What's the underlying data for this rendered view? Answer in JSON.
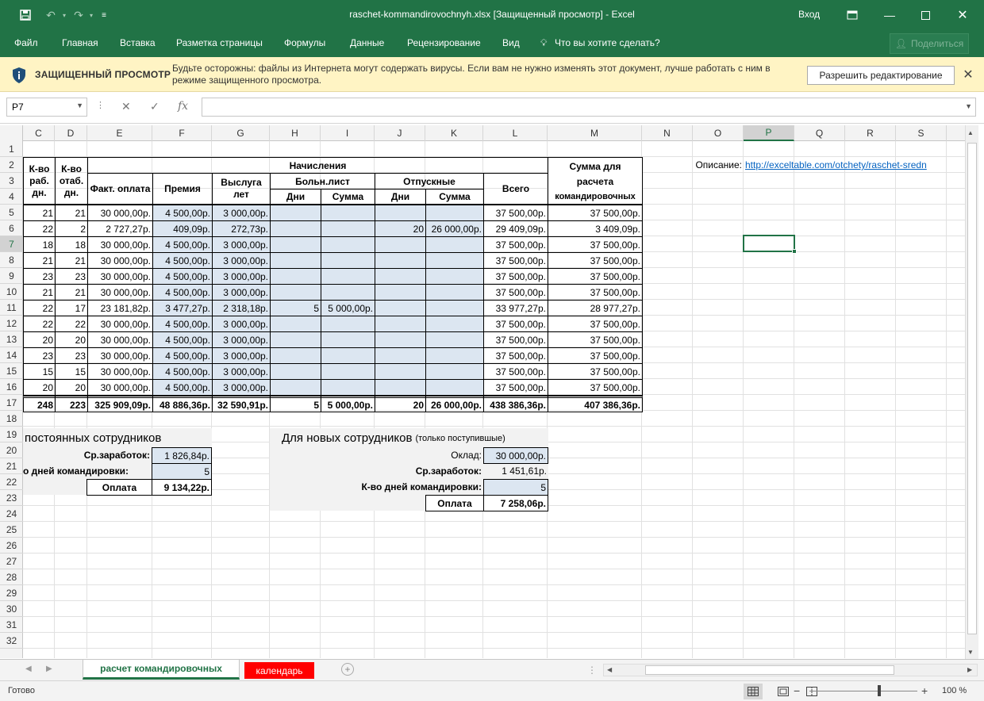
{
  "window": {
    "title": "raschet-kommandirovochnyh.xlsx  [Защищенный просмотр]  -  Excel",
    "login": "Вход"
  },
  "ribbon": {
    "tabs": [
      "Файл",
      "Главная",
      "Вставка",
      "Разметка страницы",
      "Формулы",
      "Данные",
      "Рецензирование",
      "Вид"
    ],
    "tell_me": "Что вы хотите сделать?",
    "share": "Поделиться"
  },
  "protected_view": {
    "title": "ЗАЩИЩЕННЫЙ ПРОСМОТР",
    "message": "Будьте осторожны: файлы из Интернета могут содержать вирусы. Если вам не нужно изменять этот документ, лучше работать с ним в режиме защищенного просмотра.",
    "enable_button": "Разрешить редактирование"
  },
  "formula_bar": {
    "name_box": "P7",
    "formula": ""
  },
  "columns": [
    "C",
    "D",
    "E",
    "F",
    "G",
    "H",
    "I",
    "J",
    "K",
    "L",
    "M",
    "N",
    "O",
    "P",
    "Q",
    "R",
    "S"
  ],
  "rows": [
    "1",
    "2",
    "3",
    "4",
    "5",
    "6",
    "7",
    "8",
    "9",
    "10",
    "11",
    "12",
    "13",
    "14",
    "15",
    "16",
    "17",
    "18",
    "19",
    "20",
    "21",
    "22",
    "23",
    "24",
    "25",
    "26",
    "27",
    "28",
    "29",
    "30",
    "31",
    "32"
  ],
  "header": {
    "c_work_days": "К-во раб. дн.",
    "d_tab_days": "К-во отаб. дн.",
    "accruals": "Начисления",
    "fact_pay": "Факт. оплата",
    "bonus": "Премия",
    "seniority": "Выслуга лет",
    "sick": "Больн.лист",
    "vacation": "Отпускные",
    "days": "Дни",
    "sum": "Сумма",
    "total": "Всего",
    "m_line1": "Сумма для",
    "m_line2": "расчета",
    "m_line3": "командировочных"
  },
  "table_rows": [
    [
      "21",
      "21",
      "30 000,00р.",
      "4 500,00р.",
      "3 000,00р.",
      "",
      "",
      "",
      "",
      "37 500,00р.",
      "37 500,00р."
    ],
    [
      "22",
      "2",
      "2 727,27р.",
      "409,09р.",
      "272,73р.",
      "",
      "",
      "20",
      "26 000,00р.",
      "29 409,09р.",
      "3 409,09р."
    ],
    [
      "18",
      "18",
      "30 000,00р.",
      "4 500,00р.",
      "3 000,00р.",
      "",
      "",
      "",
      "",
      "37 500,00р.",
      "37 500,00р."
    ],
    [
      "21",
      "21",
      "30 000,00р.",
      "4 500,00р.",
      "3 000,00р.",
      "",
      "",
      "",
      "",
      "37 500,00р.",
      "37 500,00р."
    ],
    [
      "23",
      "23",
      "30 000,00р.",
      "4 500,00р.",
      "3 000,00р.",
      "",
      "",
      "",
      "",
      "37 500,00р.",
      "37 500,00р."
    ],
    [
      "21",
      "21",
      "30 000,00р.",
      "4 500,00р.",
      "3 000,00р.",
      "",
      "",
      "",
      "",
      "37 500,00р.",
      "37 500,00р."
    ],
    [
      "22",
      "17",
      "23 181,82р.",
      "3 477,27р.",
      "2 318,18р.",
      "5",
      "5 000,00р.",
      "",
      "",
      "33 977,27р.",
      "28 977,27р."
    ],
    [
      "22",
      "22",
      "30 000,00р.",
      "4 500,00р.",
      "3 000,00р.",
      "",
      "",
      "",
      "",
      "37 500,00р.",
      "37 500,00р."
    ],
    [
      "20",
      "20",
      "30 000,00р.",
      "4 500,00р.",
      "3 000,00р.",
      "",
      "",
      "",
      "",
      "37 500,00р.",
      "37 500,00р."
    ],
    [
      "23",
      "23",
      "30 000,00р.",
      "4 500,00р.",
      "3 000,00р.",
      "",
      "",
      "",
      "",
      "37 500,00р.",
      "37 500,00р."
    ],
    [
      "15",
      "15",
      "30 000,00р.",
      "4 500,00р.",
      "3 000,00р.",
      "",
      "",
      "",
      "",
      "37 500,00р.",
      "37 500,00р."
    ],
    [
      "20",
      "20",
      "30 000,00р.",
      "4 500,00р.",
      "3 000,00р.",
      "",
      "",
      "",
      "",
      "37 500,00р.",
      "37 500,00р."
    ]
  ],
  "totals": [
    "248",
    "223",
    "325 909,09р.",
    "48 886,36р.",
    "32 590,91р.",
    "5",
    "5 000,00р.",
    "20",
    "26 000,00р.",
    "438 386,36р.",
    "407 386,36р."
  ],
  "description": {
    "label": "Описание:",
    "link": "http://exceltable.com/otchety/raschet-sredn"
  },
  "permanent": {
    "title": "постоянных сотрудников",
    "avg_label": "Ср.заработок:",
    "avg_value": "1 826,84р.",
    "days_label": "о дней командировки:",
    "days_value": "5",
    "pay_label": "Оплата",
    "pay_value": "9 134,22р."
  },
  "newcomers": {
    "title": "Для новых сотрудников",
    "subtitle": "(только поступившые)",
    "salary_label": "Оклад:",
    "salary_value": "30 000,00р.",
    "avg_label": "Ср.заработок:",
    "avg_value": "1 451,61р.",
    "days_label": "К-во дней командировки:",
    "days_value": "5",
    "pay_label": "Оплата",
    "pay_value": "7 258,06р."
  },
  "sheets": [
    "расчет командировочных",
    "календарь"
  ],
  "status": {
    "ready": "Готово",
    "zoom": "100 %"
  },
  "colors": {
    "excel_green": "#217346",
    "input_blue": "#dce6f1",
    "warning_bar": "#fff4c4",
    "calendar_tab": "#ff0000"
  }
}
